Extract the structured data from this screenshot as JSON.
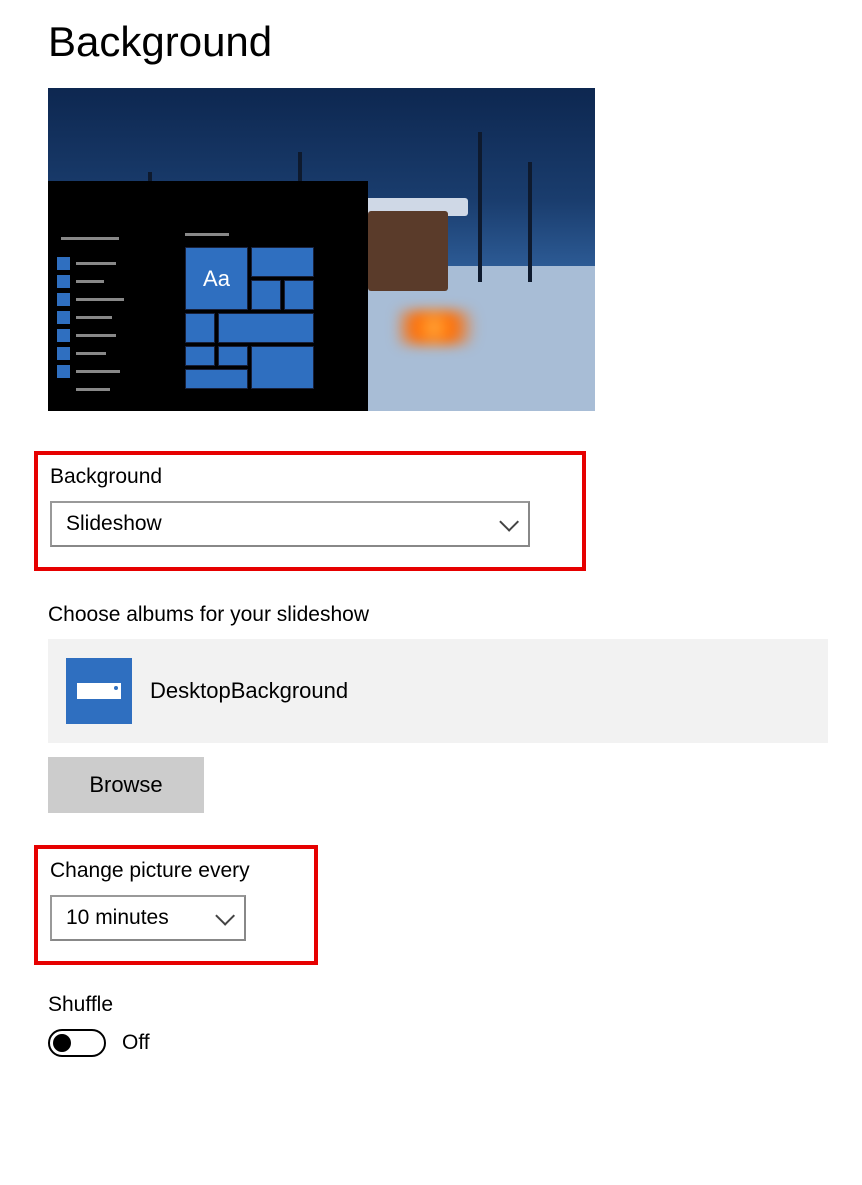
{
  "page": {
    "title": "Background"
  },
  "preview": {
    "tile_text": "Aa"
  },
  "background_select": {
    "label": "Background",
    "value": "Slideshow"
  },
  "albums": {
    "label": "Choose albums for your slideshow",
    "selected_name": "DesktopBackground",
    "browse_label": "Browse"
  },
  "interval": {
    "label": "Change picture every",
    "value": "10 minutes"
  },
  "shuffle": {
    "label": "Shuffle",
    "state": "Off"
  }
}
